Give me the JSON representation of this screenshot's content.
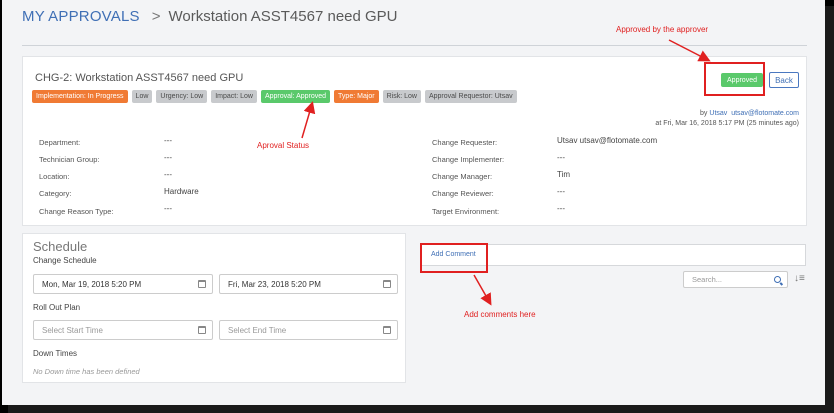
{
  "breadcrumb": {
    "link": "MY APPROVALS",
    "sep": ">",
    "title": "Workstation ASST4567 need GPU"
  },
  "change": {
    "title": "CHG-2: Workstation ASST4567 need GPU",
    "badges": [
      {
        "label": "Implementation: In Progress",
        "color": "#f07a34"
      },
      {
        "label": "Low",
        "color": "#c8cacd"
      },
      {
        "label": "Urgency: Low",
        "color": "#c8cacd"
      },
      {
        "label": "Impact: Low",
        "color": "#c8cacd"
      },
      {
        "label": "Approval: Approved",
        "color": "#5ac96b"
      },
      {
        "label": "Type: Major",
        "color": "#f07a34"
      },
      {
        "label": "Risk: Low",
        "color": "#c8cacd"
      },
      {
        "label": "Approval Requestor: Utsav",
        "color": "#c8cacd"
      }
    ],
    "approved_label": "Approved",
    "back_label": "Back",
    "meta": {
      "by": "by",
      "user": "Utsav",
      "email": "utsav@flotomate.com",
      "at": "at Fri, Mar 16, 2018 5:17 PM (25 minutes ago)"
    },
    "fields_left": [
      {
        "label": "Department:",
        "value": "---"
      },
      {
        "label": "Technician Group:",
        "value": "---"
      },
      {
        "label": "Location:",
        "value": "---"
      },
      {
        "label": "Category:",
        "value": "Hardware"
      },
      {
        "label": "Change Reason Type:",
        "value": "---"
      }
    ],
    "fields_right": [
      {
        "label": "Change Requester:",
        "value": "Utsav utsav@flotomate.com"
      },
      {
        "label": "Change Implementer:",
        "value": "---"
      },
      {
        "label": "Change Manager:",
        "value": "Tim"
      },
      {
        "label": "Change Reviewer:",
        "value": "---"
      },
      {
        "label": "Target Environment:",
        "value": "---"
      }
    ]
  },
  "schedule": {
    "title": "Schedule",
    "change_schedule_label": "Change Schedule",
    "start": "Mon, Mar 19, 2018 5:20 PM",
    "end": "Fri, Mar 23, 2018 5:20 PM",
    "rollout_label": "Roll Out Plan",
    "start_placeholder": "Select Start Time",
    "end_placeholder": "Select End Time",
    "downtimes_label": "Down Times",
    "no_downtime": "No Down time has been defined"
  },
  "comments": {
    "add_label": "Add Comment",
    "search_placeholder": "Search..."
  },
  "annotations": {
    "approved": "Approved by the approver",
    "status": "Aproval Status",
    "comments": "Add comments here"
  },
  "colors": {
    "accent": "#3f6fb5",
    "annotation": "#e02020"
  }
}
